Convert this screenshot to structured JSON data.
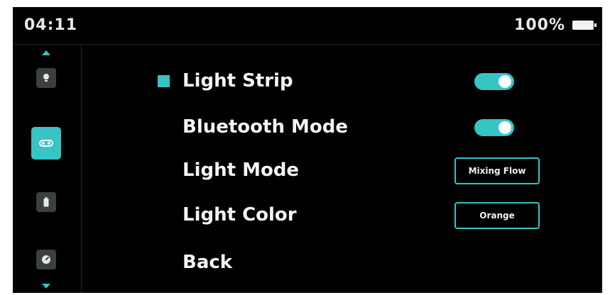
{
  "status_bar": {
    "time": "04:11",
    "battery": "100%",
    "battery_icon": "battery-full-icon"
  },
  "sidebar": {
    "up_arrow": "arrow-up-icon",
    "down_arrow": "arrow-down-icon",
    "items": [
      {
        "icon": "lightbulb-icon",
        "active": false
      },
      {
        "icon": "light-strip-icon",
        "active": true
      },
      {
        "icon": "battery-icon",
        "active": false
      },
      {
        "icon": "gauge-icon",
        "active": false
      }
    ]
  },
  "menu": {
    "light_strip": {
      "label": "Light Strip",
      "toggle_on": true
    },
    "bluetooth_mode": {
      "label": "Bluetooth Mode",
      "toggle_on": true
    },
    "light_mode": {
      "label": "Light Mode",
      "value": "Mixing Flow"
    },
    "light_color": {
      "label": "Light Color",
      "value": "Orange"
    },
    "back": {
      "label": "Back"
    }
  },
  "colors": {
    "accent": "#36c4c4",
    "background": "#000000",
    "text": "#f5f5f5",
    "inactive_icon": "#3a3f40"
  }
}
